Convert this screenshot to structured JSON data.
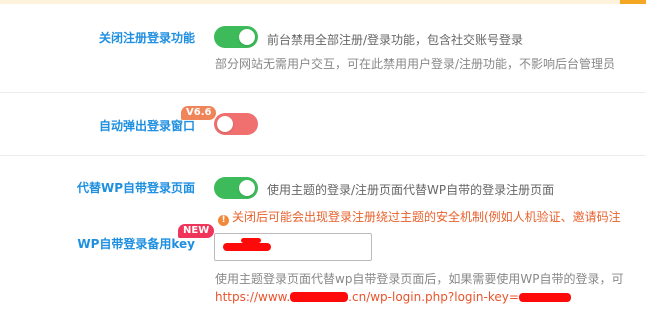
{
  "settings": [
    {
      "label": "关闭注册登录功能",
      "state": "on",
      "description": "前台禁用全部注册/登录功能，包含社交账号登录",
      "note": "部分网站无需用户交互，可在此禁用用户登录/注册功能，不影响后台管理员"
    },
    {
      "label": "自动弹出登录窗口",
      "badge": "V6.6",
      "state": "off"
    },
    {
      "label": "代替WP自带登录页面",
      "state": "on",
      "description": "使用主题的登录/注册页面代替WP自带的登录注册页面",
      "warning": "关闭后可能会出现登录注册绕过主题的安全机制(例如人机验证、邀请码注"
    },
    {
      "label": "WP自带登录备用key",
      "badge": "NEW",
      "note": "使用主题登录页面代替wp自带登录页面后，如果需要使用WP自带的登录，可",
      "url_prefix": "https://www.",
      "url_middle": ".cn/wp-login.php?login-key="
    }
  ],
  "colors": {
    "label": "#1f8fe0",
    "toggle_on": "#3dbb5a",
    "toggle_off": "#f07070",
    "badge_orange": "#f0855a",
    "badge_red": "#f0355a",
    "warning": "#e8612c"
  }
}
